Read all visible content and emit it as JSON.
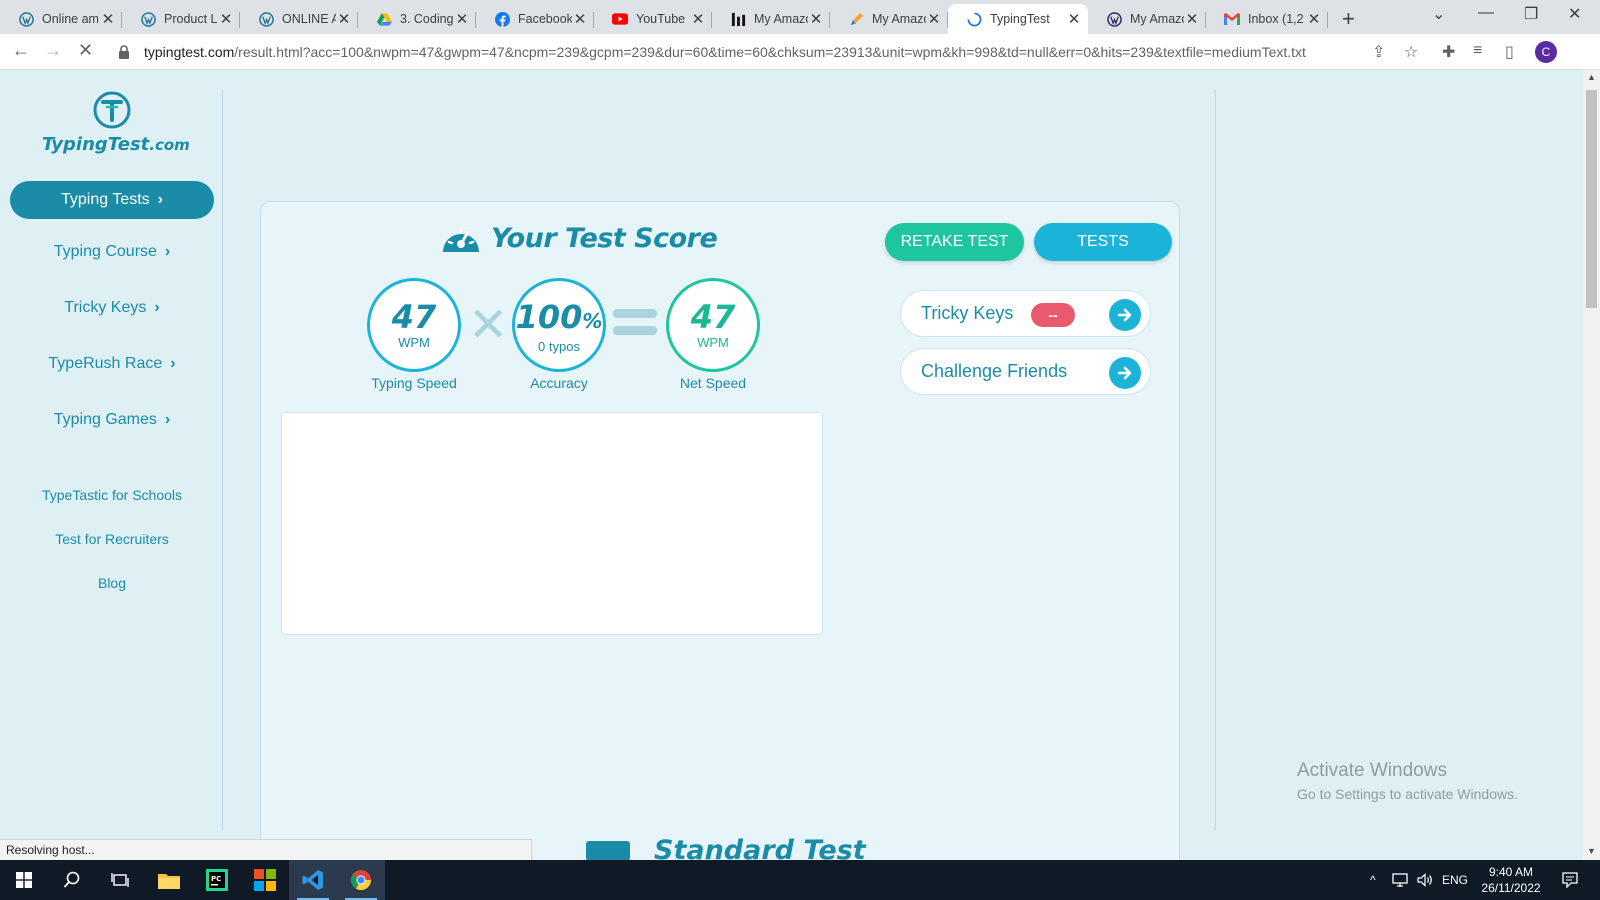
{
  "browser": {
    "tabs": [
      {
        "title": "Online am",
        "icon": "wordpress-icon"
      },
      {
        "title": "Product Lis",
        "icon": "wordpress-icon"
      },
      {
        "title": "ONLINE AI",
        "icon": "wordpress-icon"
      },
      {
        "title": "3. Coding",
        "icon": "google-drive-icon"
      },
      {
        "title": "Facebook",
        "icon": "facebook-icon"
      },
      {
        "title": "YouTube",
        "icon": "youtube-icon"
      },
      {
        "title": "My Amazo",
        "icon": "bar-chart-icon"
      },
      {
        "title": "My Amazo",
        "icon": "pen-icon"
      },
      {
        "title": "TypingTest",
        "icon": "loading-spinner-icon",
        "active": true
      },
      {
        "title": "My Amazo",
        "icon": "wordpress-icon"
      },
      {
        "title": "Inbox (1,2",
        "icon": "gmail-icon"
      }
    ],
    "url_host": "typingtest.com",
    "url_path": "/result.html?acc=100&nwpm=47&gwpm=47&ncpm=239&gcpm=239&dur=60&time=60&chksum=23913&unit=wpm&kh=998&td=null&err=0&hits=239&textfile=mediumText.txt",
    "profile_initial": "C",
    "status_text": "Resolving host..."
  },
  "sidebar": {
    "logo_text": "TypingTest",
    "logo_suffix": ".com",
    "primary": "Typing Tests",
    "items": [
      "Typing Course",
      "Tricky Keys",
      "TypeRush Race",
      "Typing Games"
    ],
    "links": [
      "TypeTastic for Schools",
      "Test for Recruiters",
      "Blog"
    ]
  },
  "score": {
    "title": "Your Test Score",
    "retake_label": "RETAKE TEST",
    "tests_label": "TESTS",
    "typing_speed": {
      "value": "47",
      "unit": "WPM",
      "label": "Typing Speed"
    },
    "accuracy": {
      "value": "100",
      "unit": "%",
      "sub": "0 typos",
      "label": "Accuracy"
    },
    "net_speed": {
      "value": "47",
      "unit": "WPM",
      "label": "Net Speed"
    },
    "tricky_keys_label": "Tricky Keys",
    "tricky_keys_badge": "--",
    "challenge_label": "Challenge Friends",
    "next_section": "Standard Test"
  },
  "watermark": {
    "line1": "Activate Windows",
    "line2": "Go to Settings to activate Windows."
  },
  "taskbar": {
    "language": "ENG",
    "time": "9:40 AM",
    "date": "26/11/2022"
  },
  "colors": {
    "brand": "#1a8ca8",
    "teal": "#1ec6a0",
    "blue": "#1bb4d8",
    "badge": "#ea5a6e"
  }
}
